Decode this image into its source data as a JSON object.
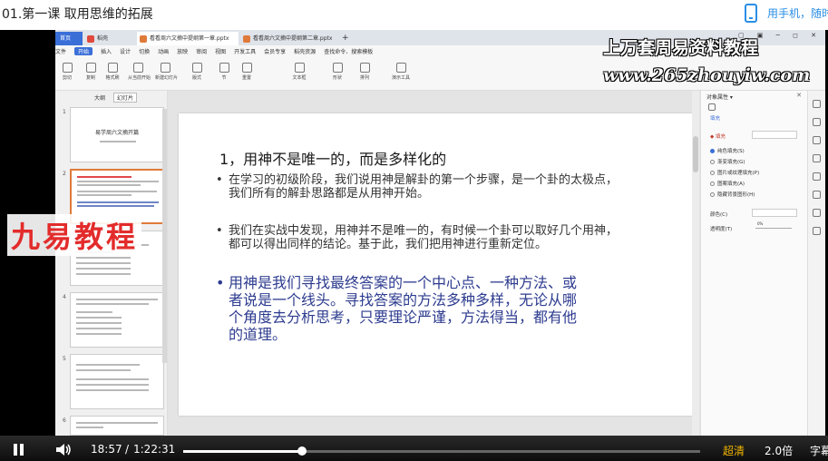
{
  "page": {
    "course_title": "01.第一课 取用思维的拓展",
    "phone_text": "用手机，随时"
  },
  "wps": {
    "tabs": [
      "首页",
      "稻壳",
      "看看周六文摘中提纲第一章.pptx",
      "看看周六文摘中提纲第二章.pptx",
      "+"
    ],
    "menu": [
      "文件",
      "开始",
      "插入",
      "设计",
      "切换",
      "动画",
      "放映",
      "审阅",
      "视图",
      "开发工具",
      "会员专享",
      "稻壳资源",
      "查找命令、搜索模板"
    ],
    "menu_active_index": 1,
    "tools": [
      "剪切",
      "复制",
      "格式刷",
      "从当前开始",
      "新建幻灯片",
      "版式",
      "节",
      "重置",
      "文本框",
      "形状",
      "排列",
      "演示工具"
    ],
    "thumb_tabs": [
      "大纲",
      "幻灯片"
    ],
    "thumb_active": 1,
    "slide_numbers": [
      "1",
      "2",
      "3",
      "4",
      "5",
      "6"
    ],
    "thumb1_title": "易学周六文摘开篇",
    "properties": {
      "header": "对象属性 ▾",
      "tab": "填充",
      "section": "◆ 填充",
      "options": [
        "纯色填充(S)",
        "渐变填充(G)",
        "图片或纹理填充(P)",
        "图案填充(A)",
        "隐藏背景图形(H)"
      ],
      "selected_option": 0,
      "color_label": "颜色(C)",
      "transparency_label": "透明度(T)",
      "transparency_value": "0%"
    }
  },
  "slide": {
    "title": "1，用神不是唯一的，而是多样化的",
    "bullet1": [
      "在学习的初级阶段，我们说用神是解卦的第一个步骤，是一个卦的太极点，",
      "我们所有的解卦思路都是从用神开始。"
    ],
    "bullet2": [
      "我们在实战中发现，用神并不是唯一的，有时候一个卦可以取好几个用神，",
      "都可以得出同样的结论。基于此，我们把用神进行重新定位。"
    ],
    "bullet3": [
      "用神是我们寻找最终答案的一个中心点、一种方法、或",
      "者说是一个线头。寻找答案的方法多种多样，无论从哪",
      "个角度去分析思考，只要理论严谨，方法得当，都有他",
      "的道理。"
    ]
  },
  "watermarks": {
    "top": "上万套周易资料教程",
    "url": "www.265zhouyiw.com",
    "brand": "九易教程"
  },
  "player": {
    "current_time": "18:57",
    "separator": "/",
    "total_time": "1:22:31",
    "progress_fraction": 0.23,
    "quality": "超清",
    "speed": "2.0倍",
    "subtitle": "字幕"
  },
  "colors": {
    "accent": "#3b6fd8",
    "bullet3_text": "#2d3b8f",
    "brand_red": "#e32b2b",
    "quality": "#f0b400",
    "link_blue": "#2a8ee6"
  }
}
